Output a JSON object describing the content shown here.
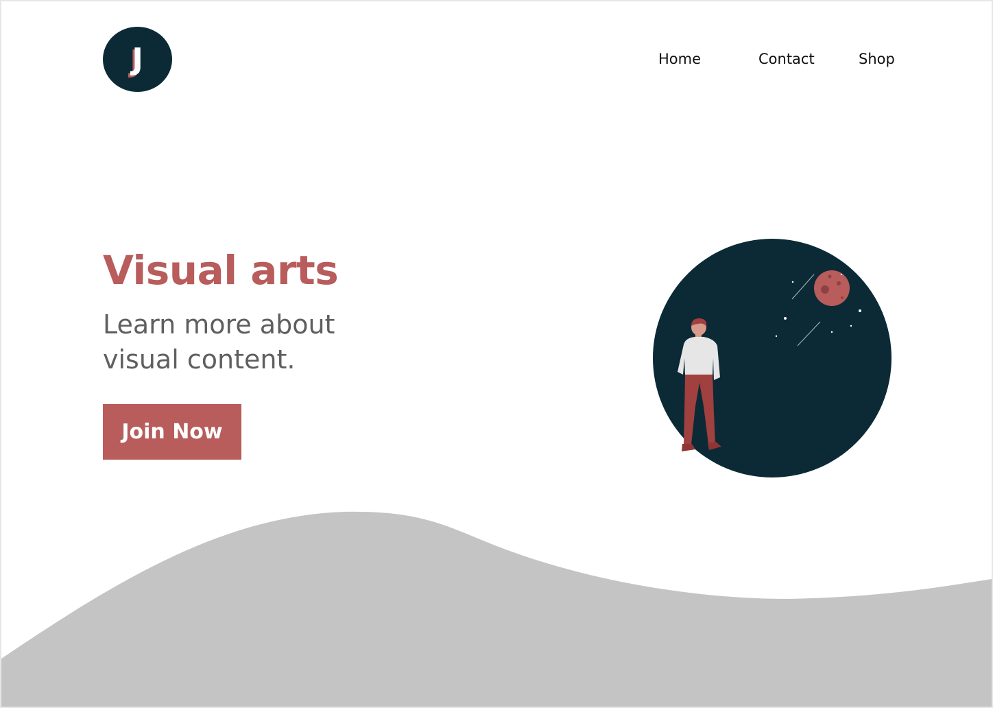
{
  "logo": {
    "letter": "J",
    "icon": "logo-j-icon"
  },
  "nav": {
    "items": [
      {
        "label": "Home"
      },
      {
        "label": "Contact"
      },
      {
        "label": "Shop"
      }
    ]
  },
  "hero": {
    "title": "Visual arts",
    "subtitle": "Learn more about visual content.",
    "cta_label": "Join Now"
  },
  "illustration": {
    "icon": "person-looking-at-space-illustration"
  },
  "colors": {
    "accent": "#b85c5c",
    "dark_navy": "#0b2a36",
    "subtitle_gray": "#5f5f5f",
    "wave_gray": "#c4c4c4",
    "shirt": "#e6e6e6",
    "pants": "#a0403f",
    "moon": "#b85c5c"
  }
}
